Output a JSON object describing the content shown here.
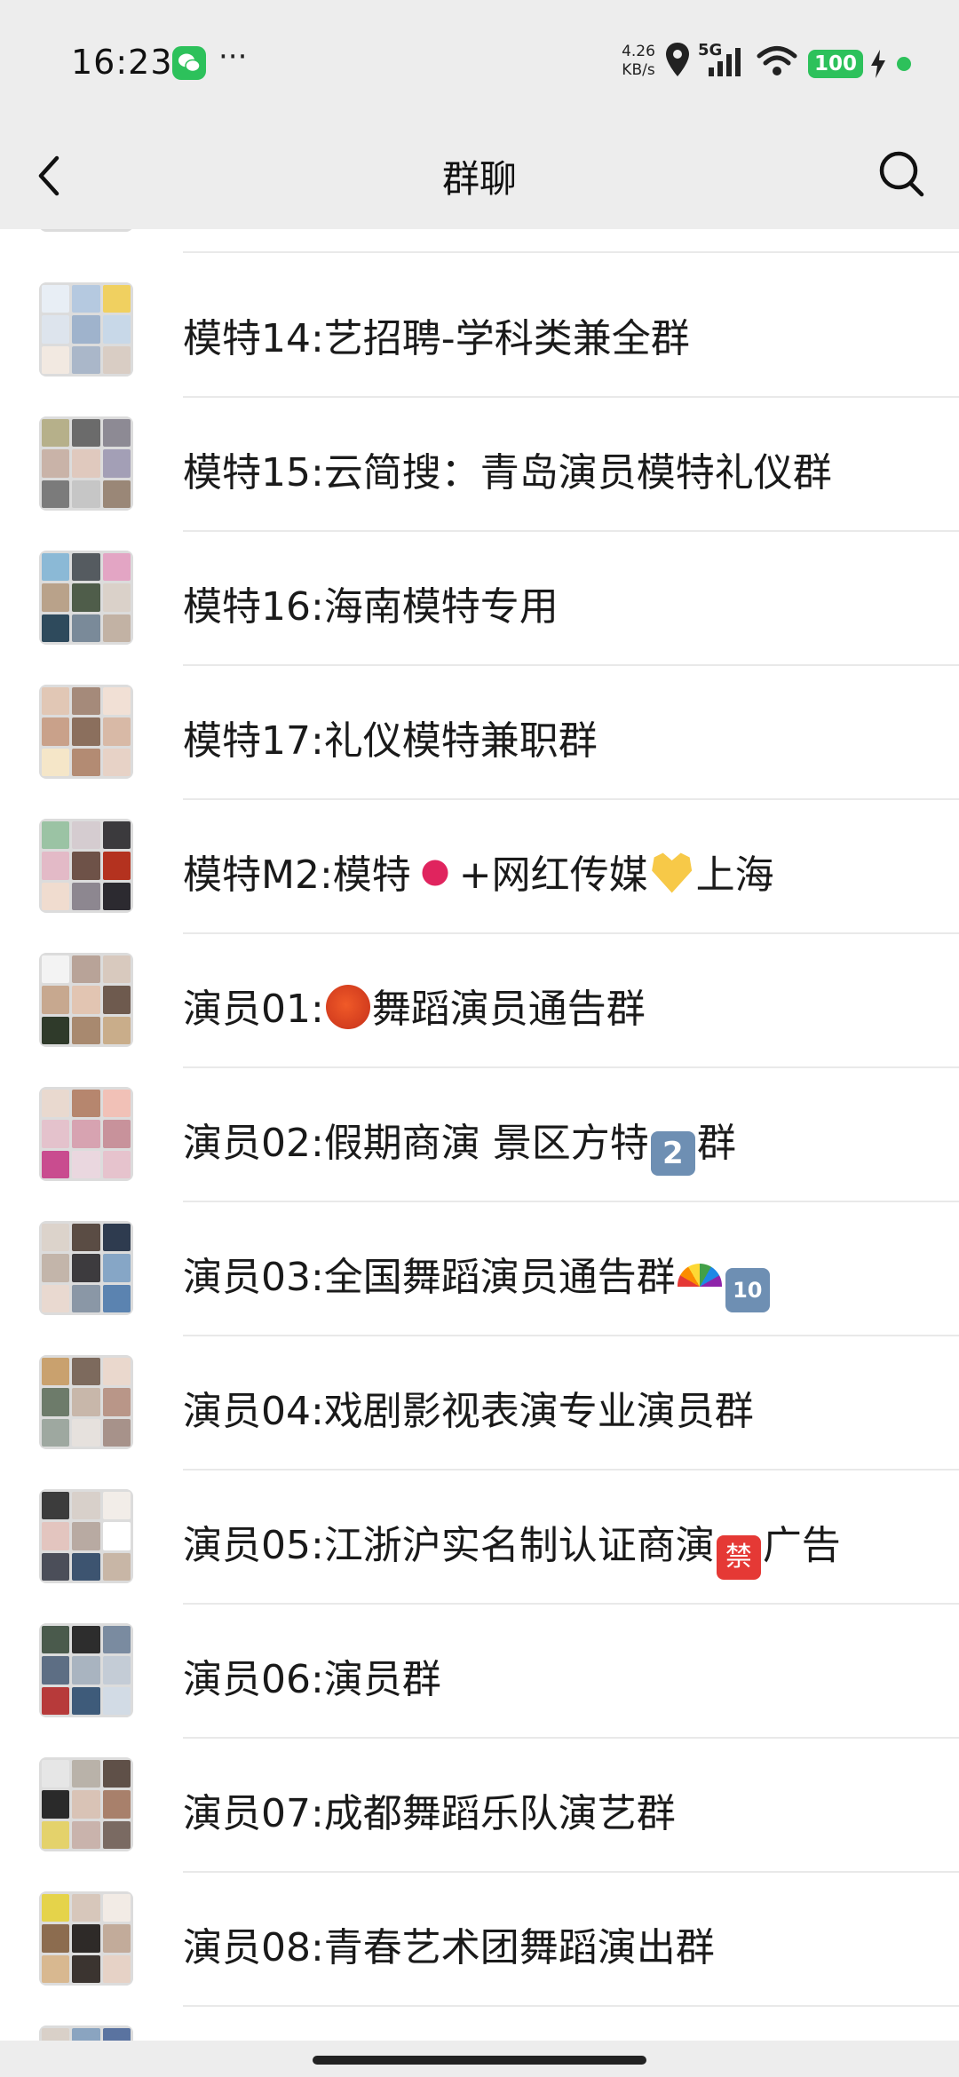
{
  "status_bar": {
    "time": "16:23",
    "more": "···",
    "net_speed_value": "4.26",
    "net_speed_unit": "KB/s",
    "network": "5G",
    "battery": "100"
  },
  "nav": {
    "title": "群聊"
  },
  "colors": {
    "background": "#ededed",
    "wechat_green": "#2dc15b"
  },
  "groups": [
    {
      "name": "模特14:艺招聘-学科类兼全群",
      "emoji": []
    },
    {
      "name": "模特15:云简搜：青岛演员模特礼仪群",
      "emoji": []
    },
    {
      "name": "模特16:海南模特专用",
      "emoji": []
    },
    {
      "name": "模特17:礼仪模特兼职群",
      "emoji": []
    },
    {
      "name_a": "模特M2:模特",
      "name_b": "+网红传媒",
      "name_c": "上海"
    },
    {
      "name_a": "演员01:",
      "name_b": "舞蹈演员通告群"
    },
    {
      "name_a": "演员02:假期商演 景区方特",
      "keycap": "2",
      "name_b": "群"
    },
    {
      "name_a": "演员03:全国舞蹈演员通告群",
      "keycap": "10"
    },
    {
      "name": "演员04:戏剧影视表演专业演员群"
    },
    {
      "name_a": "演员05:江浙沪实名制认证商演",
      "forbid": "禁",
      "name_b": "广告"
    },
    {
      "name": "演员06:演员群"
    },
    {
      "name": "演员07:成都舞蹈乐队演艺群"
    },
    {
      "name": "演员08:青春艺术团舞蹈演出群"
    }
  ]
}
